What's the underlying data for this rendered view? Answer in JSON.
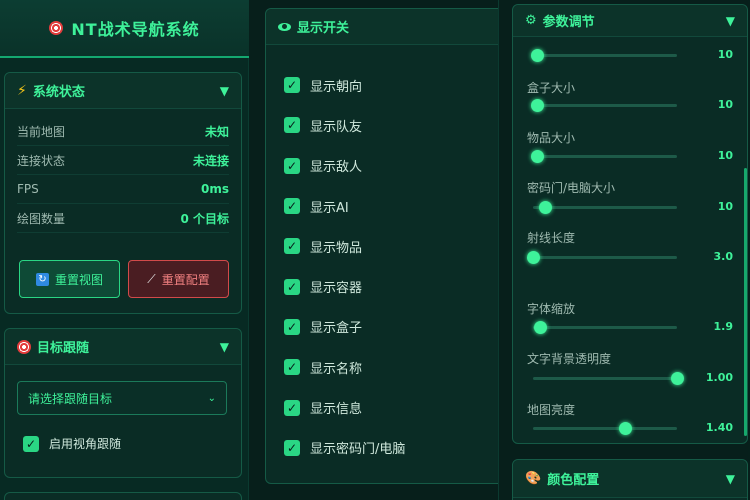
{
  "app": {
    "title": "NT战术导航系统"
  },
  "system_status": {
    "title": "系统状态",
    "rows": [
      {
        "label": "当前地图",
        "value": "未知"
      },
      {
        "label": "连接状态",
        "value": "未连接"
      },
      {
        "label": "FPS",
        "value": "0ms"
      },
      {
        "label": "绘图数量",
        "value": "0 个目标"
      }
    ],
    "reset_view_label": "重置视图",
    "reset_config_label": "重置配置"
  },
  "target_follow": {
    "title": "目标跟随",
    "select_value": "请选择跟随目标",
    "view_follow_label": "启用视角跟随"
  },
  "display_toggles": {
    "title": "显示开关",
    "items": [
      {
        "label": "显示朝向",
        "checked": true
      },
      {
        "label": "显示队友",
        "checked": true
      },
      {
        "label": "显示敌人",
        "checked": true
      },
      {
        "label": "显示AI",
        "checked": true
      },
      {
        "label": "显示物品",
        "checked": true
      },
      {
        "label": "显示容器",
        "checked": true
      },
      {
        "label": "显示盒子",
        "checked": true
      },
      {
        "label": "显示名称",
        "checked": true
      },
      {
        "label": "显示信息",
        "checked": true
      },
      {
        "label": "显示密码门/电脑",
        "checked": true
      }
    ]
  },
  "params": {
    "title": "参数调节",
    "sliders": [
      {
        "label": "",
        "value": "10",
        "fraction": 0.03
      },
      {
        "label": "盒子大小",
        "value": "10",
        "fraction": 0.03
      },
      {
        "label": "物品大小",
        "value": "10",
        "fraction": 0.03
      },
      {
        "label": "密码门/电脑大小",
        "value": "10",
        "fraction": 0.08
      },
      {
        "label": "射线长度",
        "value": "3.0",
        "fraction": 0.0
      },
      {
        "label": "字体缩放",
        "value": "1.9",
        "fraction": 0.05
      },
      {
        "label": "文字背景透明度",
        "value": "1.00",
        "fraction": 1.0
      },
      {
        "label": "地图亮度",
        "value": "1.40",
        "fraction": 0.64
      }
    ]
  },
  "color_config": {
    "title": "颜色配置"
  },
  "colors": {
    "accent": "#3ef29a",
    "danger": "#d24a4a"
  }
}
